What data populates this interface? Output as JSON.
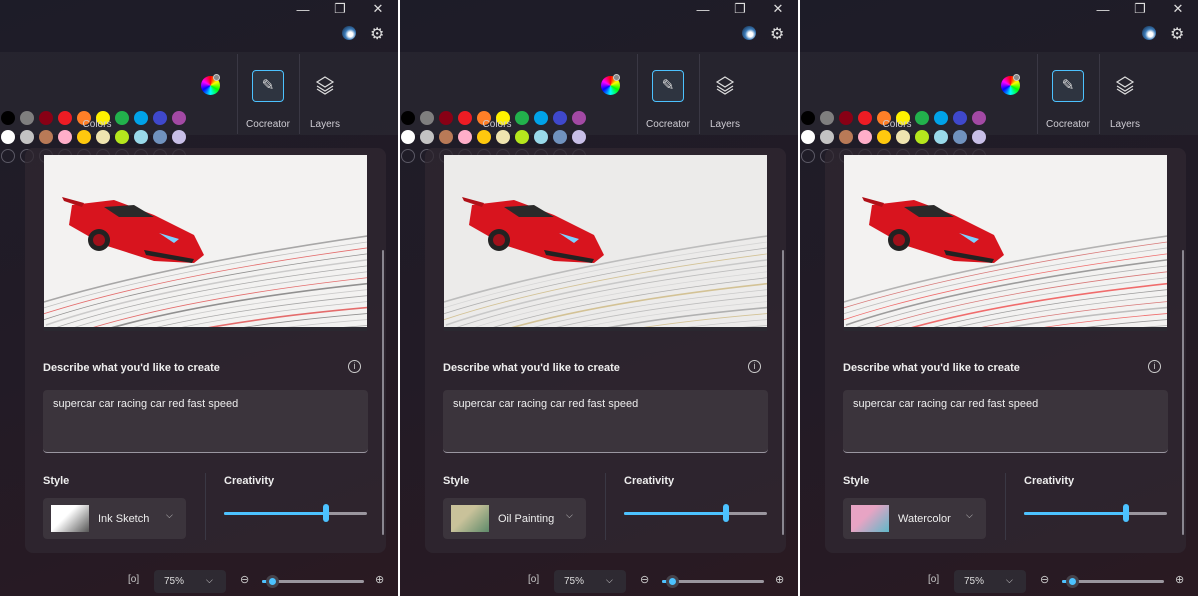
{
  "window": {
    "minimize": "—",
    "restore": "❐",
    "close": "✕"
  },
  "ribbon": {
    "colors_label": "Colors",
    "colors": [
      [
        "#000000",
        "#7f7f7f",
        "#880015",
        "#ed1c24",
        "#ff7f27",
        "#fff200",
        "#22b14c",
        "#00a2e8",
        "#3f48cc",
        "#a349a4"
      ],
      [
        "#ffffff",
        "#c3c3c3",
        "#b97a57",
        "#ffaec9",
        "#ffc90e",
        "#efe4b0",
        "#b5e61d",
        "#99d9ea",
        "#7092be",
        "#c8bfe7"
      ],
      [
        "",
        "",
        "",
        "",
        "",
        "",
        "",
        "",
        "",
        ""
      ]
    ],
    "cocreator_label": "Cocreator",
    "layers_label": "Layers"
  },
  "cocreator": {
    "describe_label": "Describe what you'd like to create",
    "prompt": "supercar car racing car red fast speed",
    "style_label": "Style",
    "creativity_label": "Creativity"
  },
  "panels": [
    {
      "style": "Ink Sketch",
      "thumb": [
        "#ffffff",
        "#555555"
      ],
      "creativity": 0.71,
      "zoom": "75%",
      "zoom_slider": 0.1,
      "image": "sketch"
    },
    {
      "style": "Oil Painting",
      "thumb": [
        "#c9c29a",
        "#5e8a6a"
      ],
      "creativity": 0.71,
      "zoom": "75%",
      "zoom_slider": 0.1,
      "image": "photo"
    },
    {
      "style": "Watercolor",
      "thumb": [
        "#e7a4c4",
        "#5fb8c9"
      ],
      "creativity": 0.71,
      "zoom": "75%",
      "zoom_slider": 0.1,
      "image": "watercolor"
    }
  ],
  "colors": {
    "accent": "#4cc2ff",
    "divider": "#ffffff"
  }
}
